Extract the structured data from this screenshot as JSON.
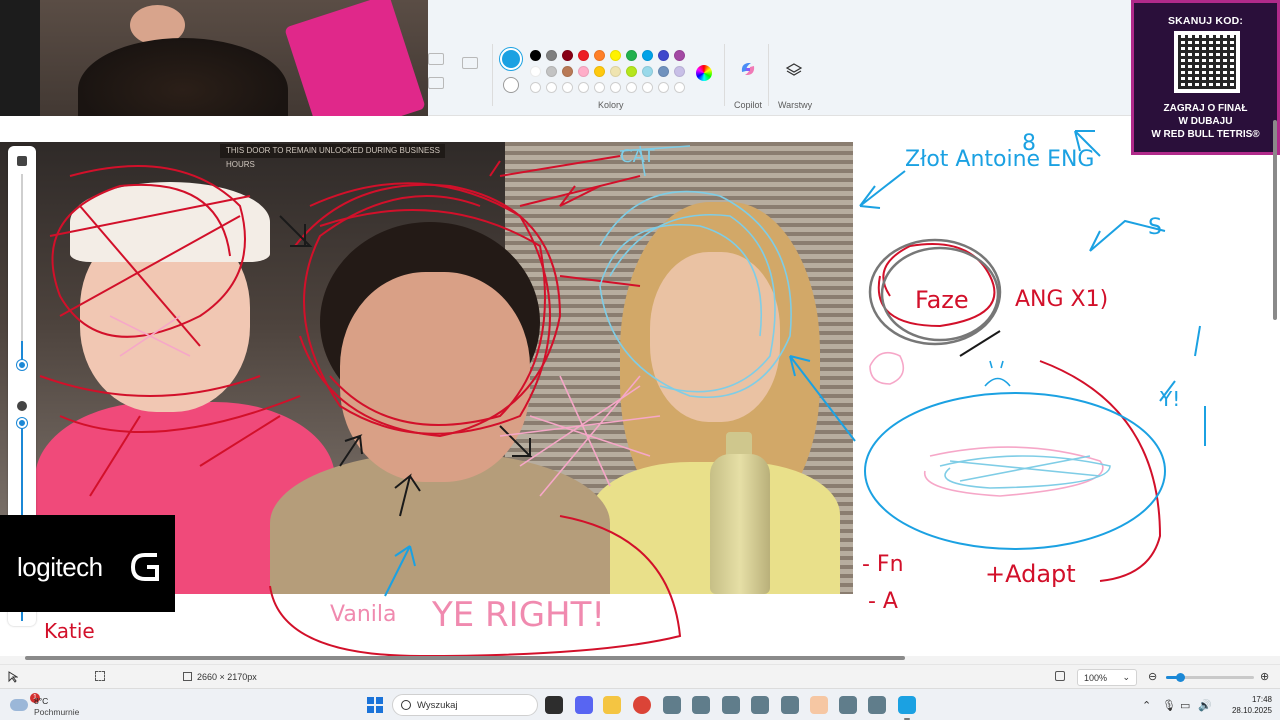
{
  "app": {
    "ribbon": {
      "group_colors_label": "Kolory",
      "group_copilot_label": "Copilot",
      "group_layers_label": "Warstwy",
      "primary_color": "#1ba1e2",
      "palette_row1": [
        "#000000",
        "#7f7f7f",
        "#880015",
        "#ed1c24",
        "#ff7f27",
        "#fff200",
        "#22b14c",
        "#00a2e8",
        "#3f48cc",
        "#a349a4"
      ],
      "palette_row2": [
        "#ffffff",
        "#c3c3c3",
        "#b97a57",
        "#ffaec9",
        "#ffc90e",
        "#efe4b0",
        "#b5e61d",
        "#99d9ea",
        "#7092be",
        "#c8bfe7"
      ],
      "palette_row3_empty": 10,
      "copilot_icon": "copilot-icon",
      "layers_icon": "layers-icon",
      "color_picker_icon": "color-wheel-icon"
    },
    "canvas": {
      "photo_sign_text": "THIS DOOR TO REMAIN UNLOCKED DURING BUSINESS HOURS",
      "annotations": {
        "zlot": "Złot Antoine ENG",
        "faze": "Faze",
        "ang": "ANG X1)",
        "fn": "- Fn",
        "a": "- A",
        "adapt": "+Adapt",
        "vanila": "Vanila",
        "ye_right": "YE RIGHT!",
        "katie": "Katie",
        "eight": "8",
        "s": "S",
        "y": "Y!",
        "cat": "CAT"
      }
    },
    "overlays": {
      "logitech": {
        "wordmark": "logitech",
        "logo_icon": "logitech-g-icon"
      },
      "qr": {
        "title": "SKANUJ KOD:",
        "line1": "ZAGRAJ O FINAŁ",
        "line2": "W DUBAJU",
        "line3": "W RED BULL TETRIS®"
      }
    },
    "statusbar": {
      "pointer_icon": "pointer-icon",
      "selection_icon": "selection-icon",
      "image_size_icon": "image-size-icon",
      "image_size": "2660 × 2170px",
      "zoom_value": "100%",
      "fit_icon": "fit-to-window-icon",
      "zoom_out_icon": "zoom-out-icon",
      "zoom_in_icon": "zoom-in-icon",
      "zoom_fraction": 0.16
    }
  },
  "taskbar": {
    "weather": {
      "temp": "8°C",
      "condition": "Pochmurnie",
      "badge": "1"
    },
    "search_placeholder": "Wyszukaj",
    "clock": {
      "time": "17:48",
      "date": "28.10.2025"
    },
    "apps": [
      "task-view-icon",
      "discord-icon",
      "file-explorer-icon",
      "chrome-icon",
      "app-icon",
      "app-icon",
      "app-icon",
      "app-icon",
      "app-icon",
      "app-icon",
      "app-icon",
      "app-icon",
      "paint-icon"
    ]
  }
}
